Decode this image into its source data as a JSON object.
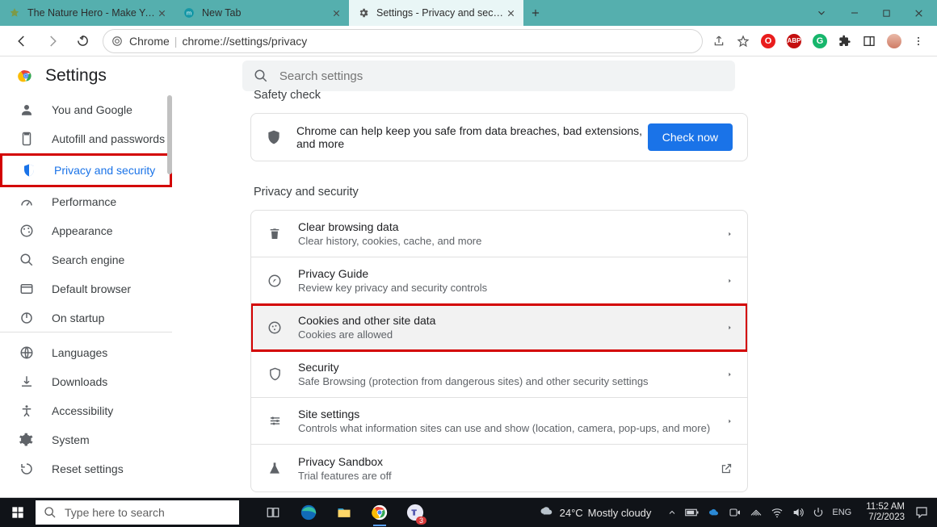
{
  "tabs": [
    {
      "title": "The Nature Hero - Make Your Ac"
    },
    {
      "title": "New Tab"
    },
    {
      "title": "Settings - Privacy and security"
    }
  ],
  "addr": {
    "scheme": "Chrome",
    "url": "chrome://settings/privacy"
  },
  "header": {
    "title": "Settings",
    "search_placeholder": "Search settings"
  },
  "sidebar": {
    "items": [
      "You and Google",
      "Autofill and passwords",
      "Privacy and security",
      "Performance",
      "Appearance",
      "Search engine",
      "Default browser",
      "On startup",
      "Languages",
      "Downloads",
      "Accessibility",
      "System",
      "Reset settings"
    ]
  },
  "safety": {
    "heading": "Safety check",
    "text": "Chrome can help keep you safe from data breaches, bad extensions, and more",
    "button": "Check now"
  },
  "ps": {
    "heading": "Privacy and security",
    "rows": [
      {
        "title": "Clear browsing data",
        "sub": "Clear history, cookies, cache, and more"
      },
      {
        "title": "Privacy Guide",
        "sub": "Review key privacy and security controls"
      },
      {
        "title": "Cookies and other site data",
        "sub": "Cookies are allowed"
      },
      {
        "title": "Security",
        "sub": "Safe Browsing (protection from dangerous sites) and other security settings"
      },
      {
        "title": "Site settings",
        "sub": "Controls what information sites can use and show (location, camera, pop-ups, and more)"
      },
      {
        "title": "Privacy Sandbox",
        "sub": "Trial features are off"
      }
    ]
  },
  "taskbar": {
    "search_placeholder": "Type here to search",
    "weather_temp": "24°C",
    "weather_text": "Mostly cloudy",
    "time": "11:52 AM",
    "date": "7/2/2023",
    "notif_badge": "3"
  }
}
